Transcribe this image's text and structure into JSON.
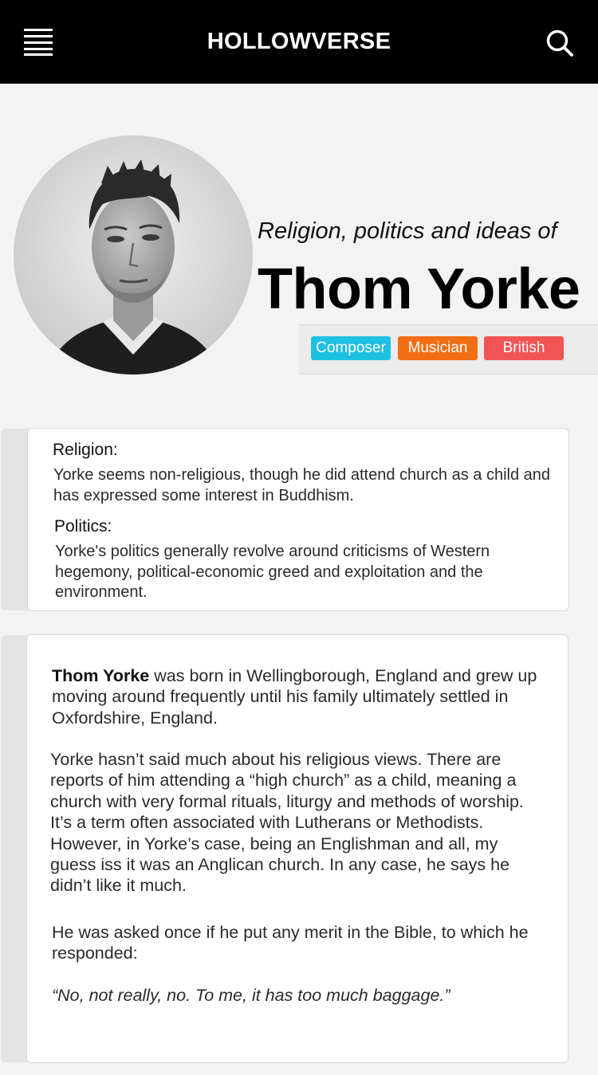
{
  "header": {
    "brand": "HOLLOWVERSE",
    "menu_icon": "hamburger-menu-icon",
    "search_icon": "search-icon"
  },
  "hero": {
    "subtitle": "Religion, politics and ideas of",
    "name": "Thom Yorke",
    "photo": "portrait-photo",
    "tags": [
      {
        "label": "Composer",
        "color": "#1fc1e2"
      },
      {
        "label": "Musician",
        "color": "#f36e12"
      },
      {
        "label": "British",
        "color": "#f25454"
      }
    ]
  },
  "summary": {
    "religion_label": "Religion:",
    "religion_text": "Yorke seems non-religious, though he did attend church as a child and has expressed some interest in Buddhism.",
    "politics_label": "Politics:",
    "politics_text": "Yorke's politics generally revolve around criticisms of Western hegemony, political-economic greed and exploitation and the environment."
  },
  "article": {
    "intro_name": "Thom Yorke",
    "intro_rest": " was born in Wellingborough, England and grew up moving around frequently until his family ultimately settled in Oxfordshire, England.",
    "para2": "Yorke hasn’t said much about his religious views. There are reports of him attending a “high church” as a child, meaning a church with very formal rituals, liturgy and methods of worship. It’s a term often associated with Lutherans or Methodists. However, in Yorke’s case, being an Englishman and all, my guess iss it was an Anglican church. In any case, he says he didn’t like it much.",
    "para3": "He was asked once if he put any merit in the Bible, to which he responded:",
    "quote": "“No, not really, no. To me, it has too much baggage.”"
  }
}
